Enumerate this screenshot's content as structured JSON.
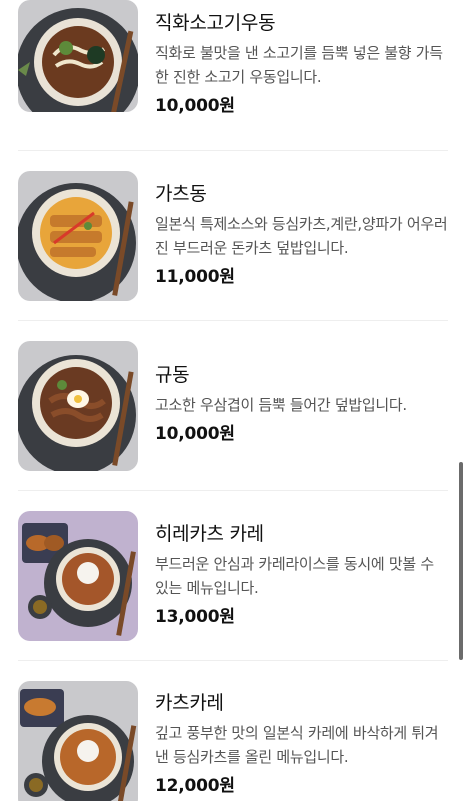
{
  "menu": {
    "items": [
      {
        "name": "직화소고기우동",
        "description": "직화로 불맛을 낸 소고기를 듬뿍 넣은 불향 가득한 진한 소고기 우동입니다.",
        "price": "10,000원",
        "image_icon": "udon-bowl-image"
      },
      {
        "name": "가츠동",
        "description": "일본식 특제소스와 등심카츠,계란,양파가 어우러진 부드러운 돈카츠 덮밥입니다.",
        "price": "11,000원",
        "image_icon": "katsudon-bowl-image"
      },
      {
        "name": "규동",
        "description": "고소한 우삼겹이 듬뿍 들어간 덮밥입니다.",
        "price": "10,000원",
        "image_icon": "gyudon-bowl-image"
      },
      {
        "name": "히레카츠 카레",
        "description": "부드러운 안심과 카레라이스를 동시에 맛볼 수 있는 메뉴입니다.",
        "price": "13,000원",
        "image_icon": "hire-katsu-curry-image"
      },
      {
        "name": "카츠카레",
        "description": "깊고 풍부한 맛의 일본식 카레에 바삭하게 튀겨낸 등심카츠를 올린 메뉴입니다.",
        "price": "12,000원",
        "image_icon": "katsu-curry-image"
      }
    ]
  },
  "colors": {
    "background": "#ffffff",
    "divider": "#eeeeee",
    "text_primary": "#111111",
    "text_secondary": "#555555",
    "scrollbar": "#6b6b6b"
  }
}
